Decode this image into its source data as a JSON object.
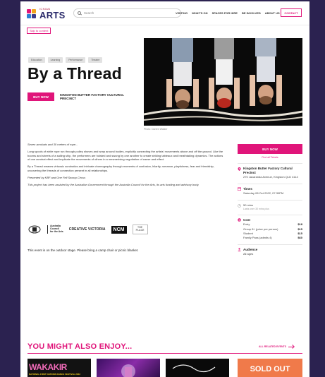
{
  "header": {
    "logo_small": "ICNIAN",
    "logo_big": "ARTS",
    "search_placeholder": "Search",
    "nav": [
      "VISITING",
      "WHAT'S ON",
      "SPACES FOR HIRE",
      "BE INVOLVED",
      "ABOUT US"
    ],
    "contact": "CONTACT"
  },
  "skip_link": "Skip to content",
  "event": {
    "tags": [
      "Education",
      "Learning",
      "Performance",
      "Theatre"
    ],
    "title": "By a Thread",
    "buy_now": "BUY NOW",
    "venue_short": "KINGSTON BUTTER FACTORY CULTURAL PRECINCT",
    "photo_credit": "Photo: Darren Walker"
  },
  "description": {
    "intro": "Seven acrobats and 30 metres of rope...",
    "p1": "Long spools of white rope run through pulley shoves and wrap around bodies, explicitly connecting the artists' movements above and off the ground. Like the booms and sheets of a sailing ship, the performers are hoisted and swung by one another to create striking tableaux and breathtaking dynamics. The actions of one acrobat effect and implicate the movements of others in a mesmerising negotiation of cause and effect.",
    "p2": "By a Thread weaves virtuosic acrobatics and intricate choreography through moments of confusion, hilarity, romance, playfulness, fear and friendship, uncovering the threads of connection present in all relationships.",
    "presented": "Presented by KBF and One Fell Swoop Circus",
    "assisted": "This project has been assisted by the Australian Government through the Australia Council for the Arts, its arts funding and advisory body.",
    "note": "This event is on the outdoor stage.  Please bring a camp chair or picnic blanket."
  },
  "funders": {
    "australia_council": [
      "Australia",
      "Council",
      "for the Arts"
    ],
    "creative_victoria": "CREATIVE VICTORIA",
    "ncm": "NCM",
    "place": "THE PLACE"
  },
  "sidebar": {
    "buy_now": "BUY NOW",
    "tickets": "Find all Tickets",
    "venue_name": "Kingston Butter Factory Cultural Precinct",
    "venue_address": "270 Jacaranda Avenue, Kingston QLD 4114",
    "times_title": "Times",
    "times_value": "Saturday 08 Oct 2022, 07:30PM",
    "duration": "50 mins",
    "duration_note": "Lasts over 30 mins plus",
    "cost_title": "Cost",
    "costs": [
      {
        "label": "Entry",
        "price": "$18"
      },
      {
        "label": "Group 8+ (price per person)",
        "price": "$15"
      },
      {
        "label": "Student",
        "price": "$15"
      },
      {
        "label": "Family Pass (admits 4)",
        "price": "$60"
      }
    ],
    "audience_title": "Audience",
    "audience_value": "All ages"
  },
  "related": {
    "title": "YOU MIGHT ALSO ENJOY...",
    "all_link": "ALL RELATED EVENTS",
    "card1_text": "WAKAKIR",
    "card1_sub": "NATIONAL FIRST NATIONS DANCE FESTIVAL 2022",
    "card4_text": "SOLD OUT"
  },
  "colors": {
    "accent": "#e0157a",
    "frame": "#2b2250",
    "logo_text": "#2b2b6b"
  }
}
